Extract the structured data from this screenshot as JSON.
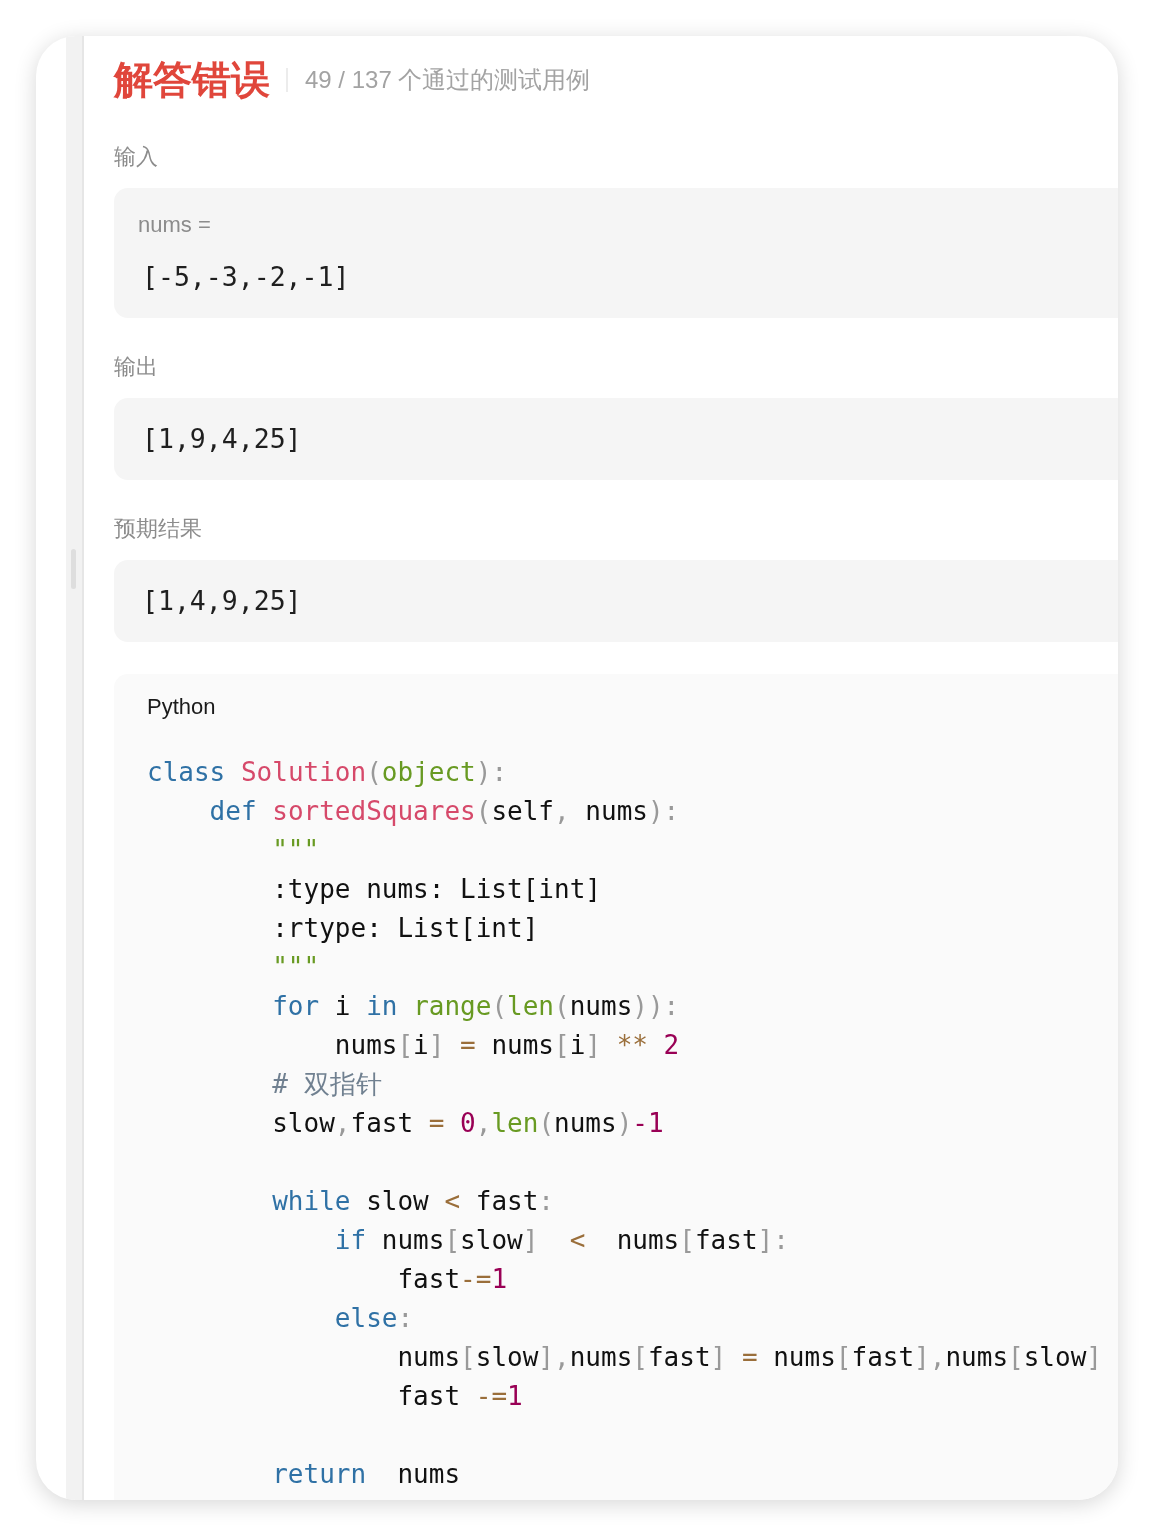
{
  "result": {
    "status": {
      "kind": "error",
      "text": "解答错误"
    },
    "passed": "49 / 137 个通过的测试用例"
  },
  "input": {
    "label": "输入",
    "params": [
      {
        "name": "nums =",
        "value": "[-5,-3,-2,-1]"
      }
    ]
  },
  "output": {
    "label": "输出",
    "value": "[1,9,4,25]"
  },
  "expected": {
    "label": "预期结果",
    "value": "[1,4,9,25]"
  },
  "code": {
    "language": "Python",
    "lines": [
      {
        "kind": "code",
        "tokens": [
          {
            "kind": "keyword",
            "text": "class "
          },
          {
            "kind": "function",
            "text": "Solution"
          },
          {
            "kind": "punctuation",
            "text": "("
          },
          {
            "kind": "builtin",
            "text": "object"
          },
          {
            "kind": "punctuation",
            "text": "):"
          }
        ],
        "children": [
          {
            "kind": "code",
            "tokens": [
              {
                "kind": "keyword",
                "text": "def "
              },
              {
                "kind": "function",
                "text": "sortedSquares"
              },
              {
                "kind": "punctuation",
                "text": "("
              },
              {
                "kind": "plain",
                "text": "self"
              },
              {
                "kind": "punctuation",
                "text": ", "
              },
              {
                "kind": "plain",
                "text": "nums"
              },
              {
                "kind": "punctuation",
                "text": "):"
              }
            ],
            "children": [
              {
                "kind": "code",
                "tokens": [
                  {
                    "kind": "string",
                    "text": "\"\"\""
                  }
                ]
              },
              {
                "kind": "code",
                "tokens": [
                  {
                    "kind": "plain",
                    "text": ":type nums: List[int]"
                  }
                ]
              },
              {
                "kind": "code",
                "tokens": [
                  {
                    "kind": "plain",
                    "text": ":rtype: List[int]"
                  }
                ]
              },
              {
                "kind": "code",
                "tokens": [
                  {
                    "kind": "string",
                    "text": "\"\"\""
                  }
                ]
              },
              {
                "kind": "code",
                "tokens": [
                  {
                    "kind": "keyword",
                    "text": "for "
                  },
                  {
                    "kind": "plain",
                    "text": "i "
                  },
                  {
                    "kind": "keyword",
                    "text": "in "
                  },
                  {
                    "kind": "builtin",
                    "text": "range"
                  },
                  {
                    "kind": "punctuation",
                    "text": "("
                  },
                  {
                    "kind": "builtin",
                    "text": "len"
                  },
                  {
                    "kind": "punctuation",
                    "text": "("
                  },
                  {
                    "kind": "plain",
                    "text": "nums"
                  },
                  {
                    "kind": "punctuation",
                    "text": ")):"
                  }
                ],
                "children": [
                  {
                    "kind": "code",
                    "tokens": [
                      {
                        "kind": "plain",
                        "text": "nums"
                      },
                      {
                        "kind": "punctuation",
                        "text": "["
                      },
                      {
                        "kind": "plain",
                        "text": "i"
                      },
                      {
                        "kind": "punctuation",
                        "text": "] "
                      },
                      {
                        "kind": "operator",
                        "text": "= "
                      },
                      {
                        "kind": "plain",
                        "text": "nums"
                      },
                      {
                        "kind": "punctuation",
                        "text": "["
                      },
                      {
                        "kind": "plain",
                        "text": "i"
                      },
                      {
                        "kind": "punctuation",
                        "text": "] "
                      },
                      {
                        "kind": "operator",
                        "text": "** "
                      },
                      {
                        "kind": "number",
                        "text": "2"
                      }
                    ]
                  }
                ]
              },
              {
                "kind": "code",
                "tokens": [
                  {
                    "kind": "comment",
                    "text": "# 双指针"
                  }
                ]
              },
              {
                "kind": "code",
                "tokens": [
                  {
                    "kind": "plain",
                    "text": "slow"
                  },
                  {
                    "kind": "punctuation",
                    "text": ","
                  },
                  {
                    "kind": "plain",
                    "text": "fast "
                  },
                  {
                    "kind": "operator",
                    "text": "= "
                  },
                  {
                    "kind": "number",
                    "text": "0"
                  },
                  {
                    "kind": "punctuation",
                    "text": ","
                  },
                  {
                    "kind": "builtin",
                    "text": "len"
                  },
                  {
                    "kind": "punctuation",
                    "text": "("
                  },
                  {
                    "kind": "plain",
                    "text": "nums"
                  },
                  {
                    "kind": "punctuation",
                    "text": ")"
                  },
                  {
                    "kind": "number",
                    "text": "-1"
                  }
                ]
              },
              {
                "kind": "blank"
              },
              {
                "kind": "code",
                "tokens": [
                  {
                    "kind": "keyword",
                    "text": "while "
                  },
                  {
                    "kind": "plain",
                    "text": "slow "
                  },
                  {
                    "kind": "operator",
                    "text": "< "
                  },
                  {
                    "kind": "plain",
                    "text": "fast"
                  },
                  {
                    "kind": "punctuation",
                    "text": ":"
                  }
                ],
                "children": [
                  {
                    "kind": "code",
                    "tokens": [
                      {
                        "kind": "keyword",
                        "text": "if "
                      },
                      {
                        "kind": "plain",
                        "text": "nums"
                      },
                      {
                        "kind": "punctuation",
                        "text": "["
                      },
                      {
                        "kind": "plain",
                        "text": "slow"
                      },
                      {
                        "kind": "punctuation",
                        "text": "]  "
                      },
                      {
                        "kind": "operator",
                        "text": "<  "
                      },
                      {
                        "kind": "plain",
                        "text": "nums"
                      },
                      {
                        "kind": "punctuation",
                        "text": "["
                      },
                      {
                        "kind": "plain",
                        "text": "fast"
                      },
                      {
                        "kind": "punctuation",
                        "text": "]:"
                      }
                    ],
                    "children": [
                      {
                        "kind": "code",
                        "tokens": [
                          {
                            "kind": "plain",
                            "text": "fast"
                          },
                          {
                            "kind": "operator",
                            "text": "-="
                          },
                          {
                            "kind": "number",
                            "text": "1"
                          }
                        ]
                      }
                    ]
                  },
                  {
                    "kind": "code",
                    "tokens": [
                      {
                        "kind": "keyword",
                        "text": "else"
                      },
                      {
                        "kind": "punctuation",
                        "text": ":"
                      }
                    ],
                    "children": [
                      {
                        "kind": "code",
                        "tokens": [
                          {
                            "kind": "plain",
                            "text": "nums"
                          },
                          {
                            "kind": "punctuation",
                            "text": "["
                          },
                          {
                            "kind": "plain",
                            "text": "slow"
                          },
                          {
                            "kind": "punctuation",
                            "text": "],"
                          },
                          {
                            "kind": "plain",
                            "text": "nums"
                          },
                          {
                            "kind": "punctuation",
                            "text": "["
                          },
                          {
                            "kind": "plain",
                            "text": "fast"
                          },
                          {
                            "kind": "punctuation",
                            "text": "] "
                          },
                          {
                            "kind": "operator",
                            "text": "= "
                          },
                          {
                            "kind": "plain",
                            "text": "nums"
                          },
                          {
                            "kind": "punctuation",
                            "text": "["
                          },
                          {
                            "kind": "plain",
                            "text": "fast"
                          },
                          {
                            "kind": "punctuation",
                            "text": "],"
                          },
                          {
                            "kind": "plain",
                            "text": "nums"
                          },
                          {
                            "kind": "punctuation",
                            "text": "["
                          },
                          {
                            "kind": "plain",
                            "text": "slow"
                          },
                          {
                            "kind": "punctuation",
                            "text": "]"
                          }
                        ]
                      },
                      {
                        "kind": "code",
                        "tokens": [
                          {
                            "kind": "plain",
                            "text": "fast "
                          },
                          {
                            "kind": "operator",
                            "text": "-="
                          },
                          {
                            "kind": "number",
                            "text": "1"
                          }
                        ]
                      }
                    ]
                  }
                ]
              },
              {
                "kind": "blank"
              },
              {
                "kind": "code",
                "tokens": [
                  {
                    "kind": "keyword",
                    "text": "return  "
                  },
                  {
                    "kind": "plain",
                    "text": "nums"
                  }
                ]
              }
            ]
          }
        ]
      }
    ]
  }
}
